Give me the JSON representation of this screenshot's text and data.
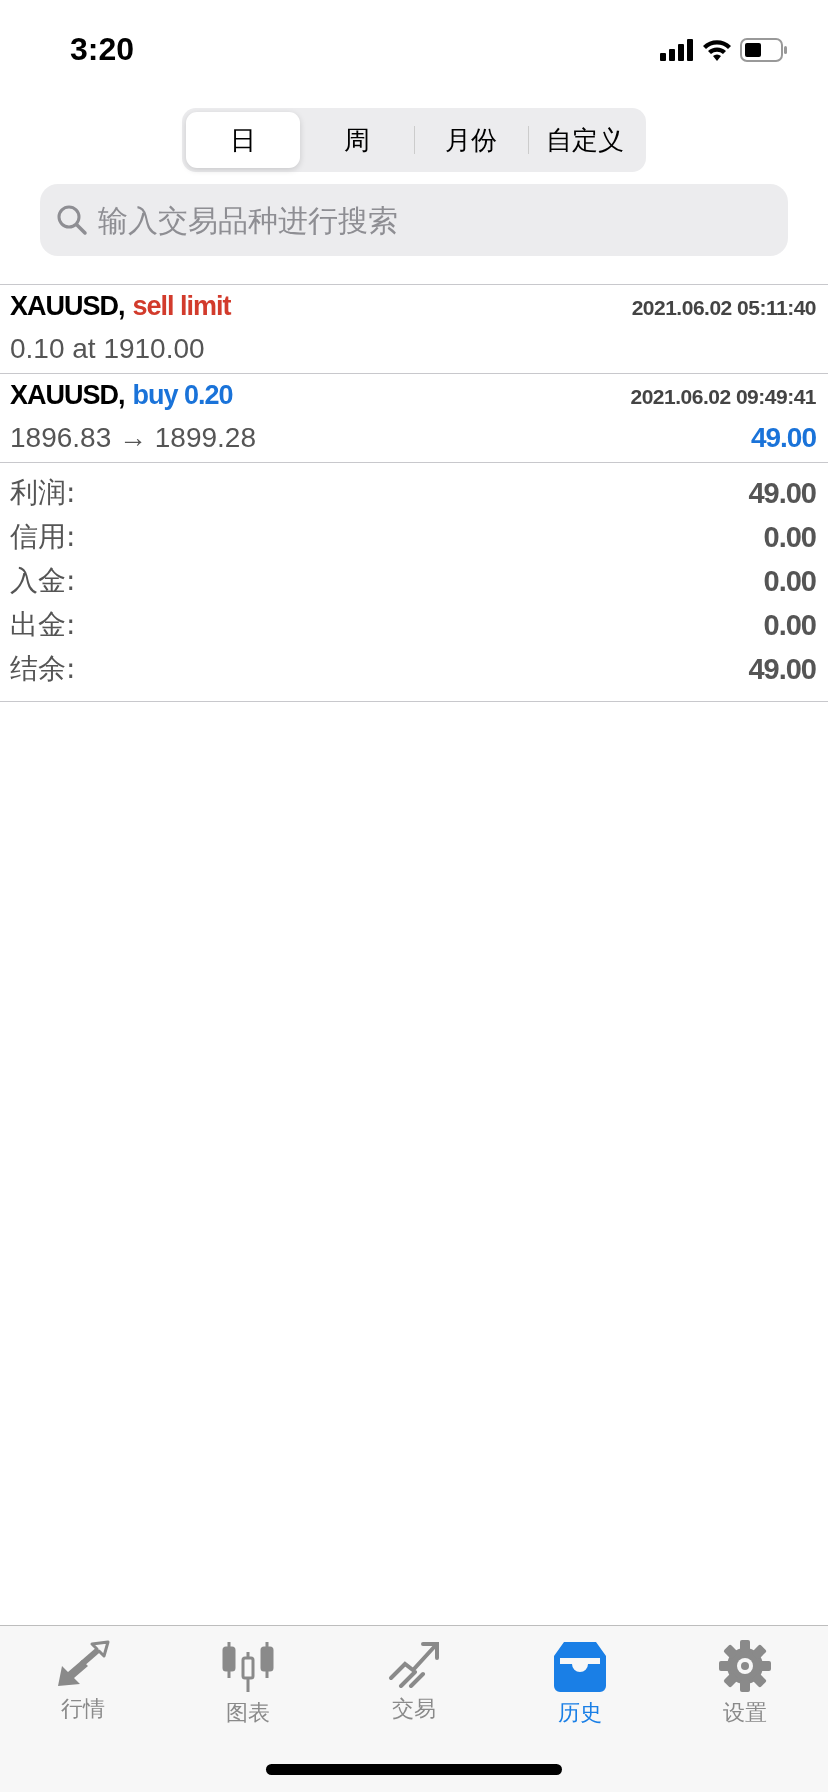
{
  "status_bar": {
    "time": "3:20"
  },
  "period_tabs": [
    {
      "label": "日",
      "selected": true
    },
    {
      "label": "周",
      "selected": false
    },
    {
      "label": "月份",
      "selected": false
    },
    {
      "label": "自定义",
      "selected": false
    }
  ],
  "search": {
    "placeholder": "输入交易品种进行搜索"
  },
  "orders": [
    {
      "symbol": "XAUUSD,",
      "type": {
        "text": "sell limit",
        "color": "#d23b2c"
      },
      "time": "2021.06.02 05:11:40",
      "detail": "0.10 at 1910.00"
    },
    {
      "symbol": "XAUUSD,",
      "type": {
        "text": "buy 0.20",
        "color": "#1a73d9"
      },
      "time": "2021.06.02 09:49:41",
      "detail": "1896.83 → 1899.28",
      "profit": "49.00"
    }
  ],
  "summary": [
    {
      "label": "利润:",
      "value": "49.00"
    },
    {
      "label": "信用:",
      "value": "0.00"
    },
    {
      "label": "入金:",
      "value": "0.00"
    },
    {
      "label": "出金:",
      "value": "0.00"
    },
    {
      "label": "结余:",
      "value": "49.00"
    }
  ],
  "tab_bar": [
    {
      "label": "行情",
      "selected": false
    },
    {
      "label": "图表",
      "selected": false
    },
    {
      "label": "交易",
      "selected": false
    },
    {
      "label": "历史",
      "selected": true
    },
    {
      "label": "设置",
      "selected": false
    }
  ]
}
